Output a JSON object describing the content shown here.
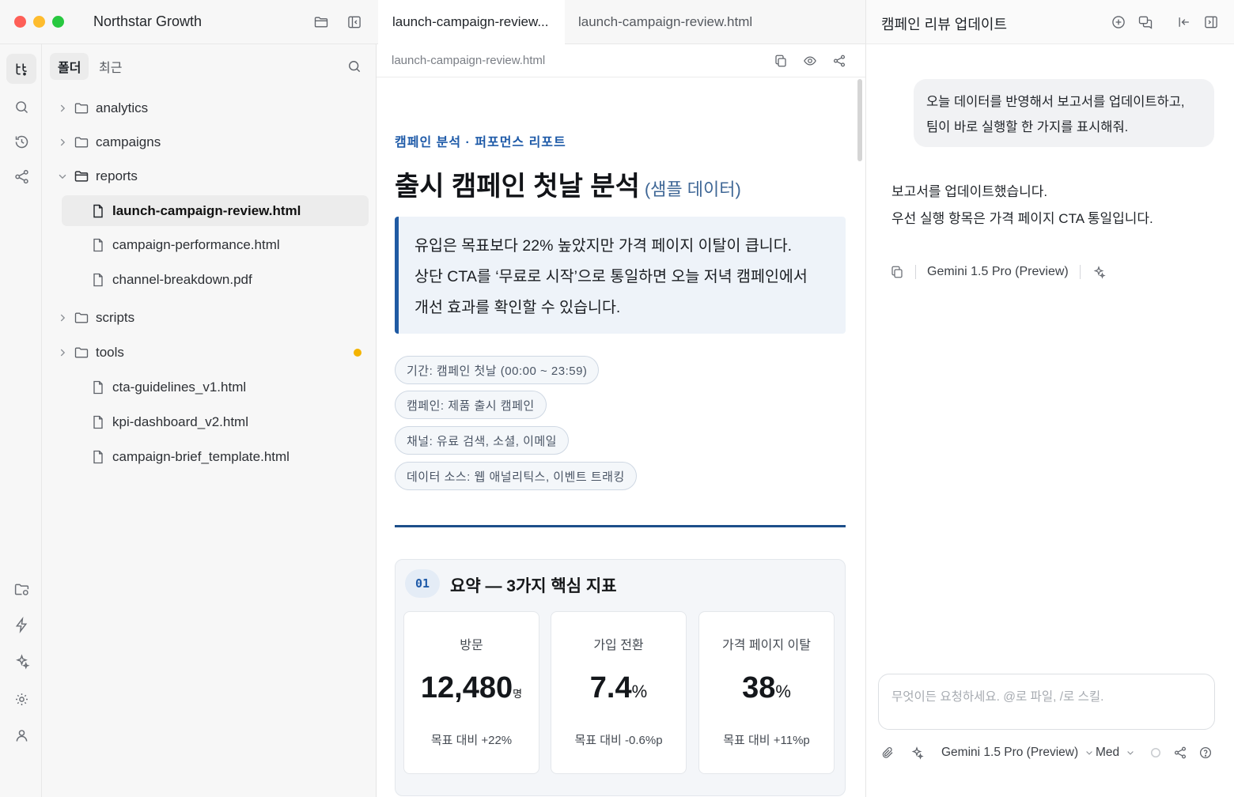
{
  "window": {
    "workspace_title": "Northstar Growth"
  },
  "explorer": {
    "tabs": [
      "폴더",
      "최근"
    ],
    "tree": [
      {
        "type": "folder",
        "label": "analytics",
        "expanded": false
      },
      {
        "type": "folder",
        "label": "campaigns",
        "expanded": false
      },
      {
        "type": "folder",
        "label": "reports",
        "expanded": true
      },
      {
        "type": "file",
        "label": "launch-campaign-review.html",
        "selected": true
      },
      {
        "type": "file",
        "label": "campaign-performance.html"
      },
      {
        "type": "file",
        "label": "channel-breakdown.pdf"
      },
      {
        "type": "folder",
        "label": "scripts",
        "expanded": false
      },
      {
        "type": "folder",
        "label": "tools",
        "expanded": false,
        "badge_color": "#f4b400"
      },
      {
        "type": "file",
        "label": "cta-guidelines_v1.html"
      },
      {
        "type": "file",
        "label": "kpi-dashboard_v2.html"
      },
      {
        "type": "file",
        "label": "campaign-brief_template.html"
      }
    ]
  },
  "editor": {
    "tabs": [
      "launch-campaign-review...",
      "launch-campaign-review.html"
    ],
    "path": "launch-campaign-review.html",
    "doc": {
      "eyebrow": "캠페인 분석 · 퍼포먼스 리포트",
      "title": "출시 캠페인 첫날 분석",
      "title_suffix": "(샘플 데이터)",
      "callout_lines": [
        "유입은 목표보다 22% 높았지만 가격 페이지 이탈이 큽니다.",
        "상단 CTA를 ‘무료로 시작’으로 통일하면 오늘 저녁 캠페인에서",
        "개선 효과를 확인할 수 있습니다."
      ],
      "chips": [
        "기간: 캠페인 첫날 (00:00 ~ 23:59)",
        "캠페인: 제품 출시 캠페인",
        "채널: 유료 검색, 소셜, 이메일",
        "데이터 소스: 웹 애널리틱스, 이벤트 트래킹"
      ],
      "section": {
        "number": "01",
        "title": "요약 — 3가지 핵심 지표",
        "kpis": [
          {
            "label": "방문",
            "value": "12,480",
            "unit": "명",
            "delta": "목표 대비 +22%"
          },
          {
            "label": "가입 전환",
            "value": "7.4",
            "unit": "%",
            "delta": "목표 대비 -0.6%p"
          },
          {
            "label": "가격 페이지 이탈",
            "value": "38",
            "unit": "%",
            "delta": "목표 대비 +11%p"
          }
        ]
      }
    }
  },
  "assistant": {
    "title": "캠페인 리뷰 업데이트",
    "user_message_lines": [
      "오늘 데이터를 반영해서 보고서를 업데이트하고,",
      "팀이 바로 실행할 한 가지를 표시해줘."
    ],
    "reply_lines": [
      "보고서를 업데이트했습니다.",
      "우선 실행 항목은 가격 페이지 CTA 통일입니다."
    ],
    "reply_model": "Gemini 1.5 Pro (Preview)",
    "composer_placeholder": "무엇이든 요청하세요. @로 파일, /로 스킬.",
    "model_selector": "Gemini 1.5 Pro (Preview)",
    "effort_selector": "Med"
  }
}
